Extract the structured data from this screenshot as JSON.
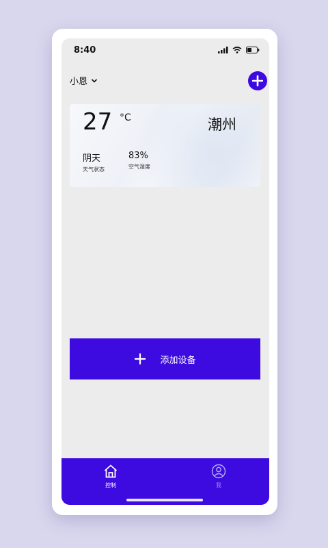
{
  "status_bar": {
    "time": "8:40"
  },
  "header": {
    "home_name": "小恩"
  },
  "weather": {
    "temperature": "27",
    "unit": "°C",
    "city": "潮州",
    "condition_value": "阴天",
    "condition_label": "天气状态",
    "humidity_value": "83%",
    "humidity_label": "空气湿度"
  },
  "add_device": {
    "label": "添加设备"
  },
  "tabs": [
    {
      "label": "控制",
      "icon": "home-icon",
      "active": true
    },
    {
      "label": "我",
      "icon": "user-icon",
      "active": false
    }
  ],
  "colors": {
    "accent": "#3d0ae0",
    "background": "#ececec",
    "frame": "#d9d7ee"
  }
}
